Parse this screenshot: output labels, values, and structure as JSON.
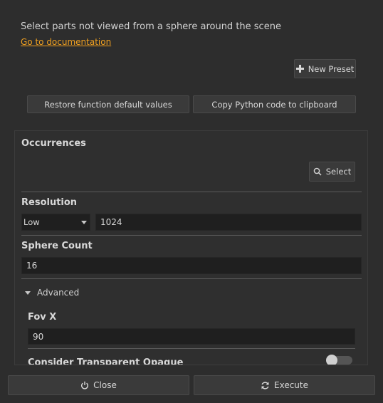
{
  "description": "Select parts not viewed from a sphere around the scene",
  "doc_link": "Go to documentation",
  "toolbar": {
    "new_preset": "New Preset",
    "restore": "Restore function default values",
    "copy_python": "Copy Python code to clipboard"
  },
  "params": {
    "occurrences": {
      "label": "Occurrences",
      "select_label": "Select"
    },
    "resolution": {
      "label": "Resolution",
      "preset": "Low",
      "value": "1024"
    },
    "sphere_count": {
      "label": "Sphere Count",
      "value": "16"
    },
    "advanced": {
      "label": "Advanced",
      "fov_x": {
        "label": "Fov X",
        "value": "90"
      },
      "consider_transparent": {
        "label": "Consider Transparent Opaque",
        "enabled": false
      }
    }
  },
  "footer": {
    "close": "Close",
    "execute": "Execute"
  },
  "colors": {
    "accent_link": "#f0a020",
    "background": "#2d2d2d"
  }
}
